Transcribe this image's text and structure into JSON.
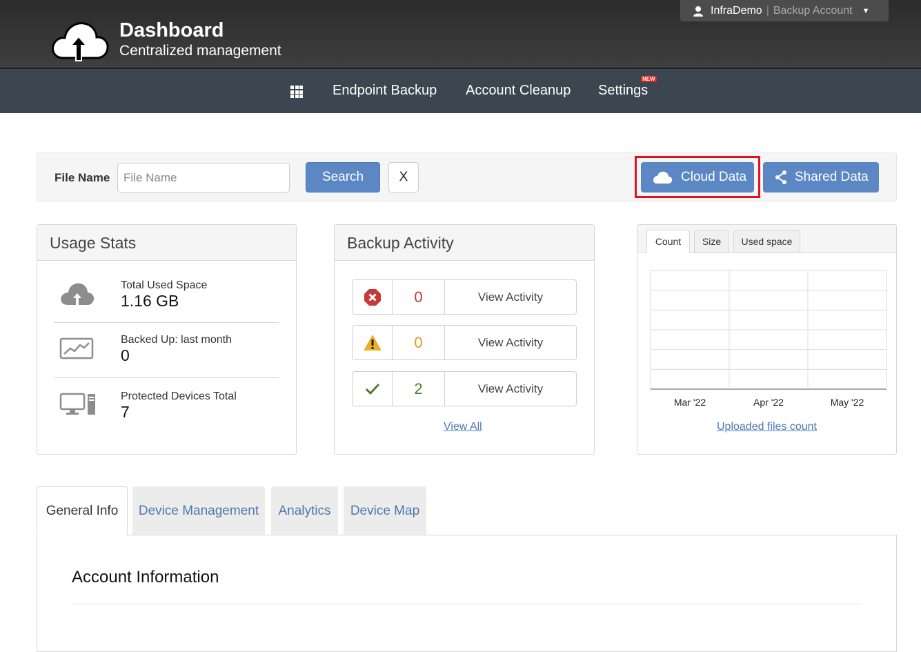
{
  "header": {
    "title": "Dashboard",
    "subtitle": "Centralized management",
    "user_name": "InfraDemo",
    "user_separator": "|",
    "account_type": "Backup Account"
  },
  "nav": {
    "items": [
      "Endpoint Backup",
      "Account Cleanup",
      "Settings"
    ],
    "new_badge": "NEW"
  },
  "search": {
    "label": "File Name",
    "placeholder": "File Name",
    "value": "",
    "search_button": "Search",
    "clear_button": "X",
    "cloud_data_button": "Cloud Data",
    "shared_data_button": "Shared Data"
  },
  "usage_stats": {
    "title": "Usage Stats",
    "items": [
      {
        "label": "Total Used Space",
        "value": "1.16 GB",
        "icon": "cloud-upload-icon"
      },
      {
        "label": "Backed Up: last month",
        "value": "0",
        "icon": "chart-monitor-icon"
      },
      {
        "label": "Protected Devices Total",
        "value": "7",
        "icon": "desktop-computer-icon"
      }
    ]
  },
  "backup_activity": {
    "title": "Backup Activity",
    "rows": [
      {
        "status": "error",
        "count": "0",
        "link": "View Activity",
        "color": "#c0392b"
      },
      {
        "status": "warning",
        "count": "0",
        "link": "View Activity",
        "color": "#d4a017"
      },
      {
        "status": "success",
        "count": "2",
        "link": "View Activity",
        "color": "#4f7a2a"
      }
    ],
    "view_all": "View All"
  },
  "chart_panel": {
    "tabs": [
      "Count",
      "Size",
      "Used space"
    ],
    "active_tab": "Count",
    "link": "Uploaded files count"
  },
  "chart_data": {
    "type": "bar",
    "categories": [
      "Mar '22",
      "Apr '22",
      "May '22"
    ],
    "values": [
      0,
      0,
      0
    ],
    "title": "",
    "xlabel": "",
    "ylabel": "",
    "grid": true
  },
  "bottom_tabs": {
    "items": [
      "General Info",
      "Device Management",
      "Analytics",
      "Device Map"
    ],
    "active": "General Info"
  },
  "account_info": {
    "title": "Account Information"
  },
  "colors": {
    "accent": "#5b87c5",
    "highlight": "#e3101e",
    "nav_bg": "#3b4650",
    "header_bg": "#333333"
  }
}
